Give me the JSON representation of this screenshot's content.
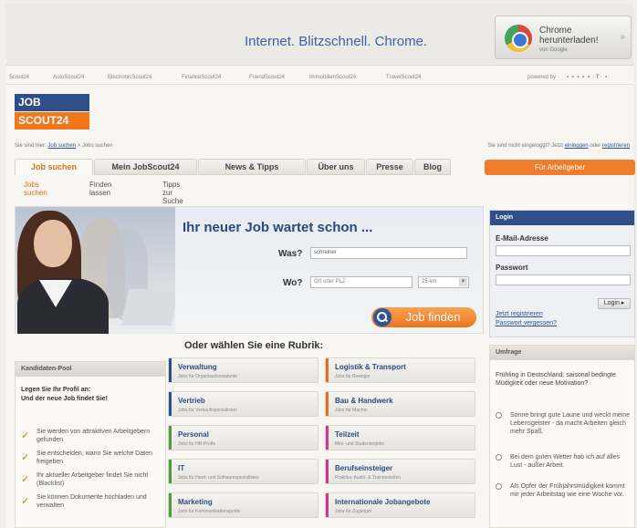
{
  "ad": {
    "slogan": "Internet. Blitzschnell. Chrome.",
    "chrome_line1": "Chrome",
    "chrome_line2": "herunterladen!",
    "chrome_sub": "von Google",
    "arrow": "»"
  },
  "network": {
    "links": [
      "Scout24",
      "AutoScout24",
      "ElectronicScout24",
      "FinanceScout24",
      "FriendScout24",
      "ImmobilienScout24",
      "TravelScout24"
    ],
    "powered_by": "powered by",
    "telekom": "• • • • • ·T· •"
  },
  "logo": {
    "line1": "JOB",
    "line2": "SCOUT24"
  },
  "breadcrumb": {
    "prefix": "Sie sind hier:",
    "link": "Job suchen",
    "current": "> Jobs suchen"
  },
  "login_status": {
    "text": "Sie sind nicht eingeloggt? Jetzt",
    "login_link": "einloggen",
    "or": "oder",
    "register_link": "registrieren"
  },
  "nav": {
    "tabs": [
      "Job suchen",
      "Mein JobScout24",
      "News & Tipps",
      "Über uns",
      "Presse",
      "Blog"
    ],
    "employer": "Für Arbeitgeber"
  },
  "subnav": [
    "Jobs suchen",
    "Finden lassen",
    "Tipps zur Suche"
  ],
  "hero": {
    "title": "Ihr neuer Job wartet schon ...",
    "was_label": "Was?",
    "was_value": "schreiner",
    "wo_label": "Wo?",
    "wo_placeholder": "Ort oder PLZ",
    "radius": "25 km",
    "button": "Job finden"
  },
  "pool": {
    "title": "Kandidaten-Pool",
    "intro_line1": "Legen Sie Ihr Profil an:",
    "intro_line2": "Und der neue Job findet Sie!",
    "items": [
      "Sie werden von attraktiven Arbeitgebern gefunden",
      "Sie entscheiden, wann Sie welche Daten freigeben",
      "Ihr aktueller Arbeitgeber findet Sie nicht (Blacklist)",
      "Sie können Dokumente hochladen und verwalten"
    ]
  },
  "rubrik": {
    "title": "Oder wählen Sie eine Rubrik:",
    "categories": [
      {
        "name": "Verwaltung",
        "sub": "Jobs für Organisationstalente",
        "color": "#2f4f89"
      },
      {
        "name": "Logistik & Transport",
        "sub": "Jobs für Beweger",
        "color": "#e07020"
      },
      {
        "name": "Vertrieb",
        "sub": "Jobs für Verkaufsspezialisten",
        "color": "#2f4f89"
      },
      {
        "name": "Bau & Handwerk",
        "sub": "Jobs für Macher",
        "color": "#e07020"
      },
      {
        "name": "Personal",
        "sub": "Jobs für HR-Profis",
        "color": "#4c9e3a"
      },
      {
        "name": "Teilzeit",
        "sub": "Mini- und Studentenjobs",
        "color": "#c93a8a"
      },
      {
        "name": "IT",
        "sub": "Jobs für Hard- und Softwarespezialisten",
        "color": "#4c9e3a"
      },
      {
        "name": "Berufseinsteiger",
        "sub": "Praktika, Ausbi- & Traineestellen",
        "color": "#c93a8a"
      },
      {
        "name": "Marketing",
        "sub": "Jobs für Kommunikationsprofis",
        "color": "#4c9e3a"
      },
      {
        "name": "Internationale Jobangebote",
        "sub": "Jobs für Zugvögel",
        "color": "#c93a8a"
      }
    ]
  },
  "login": {
    "title": "Login",
    "email_label": "E-Mail-Adresse",
    "password_label": "Passwort",
    "button": "Login ▸",
    "register": "Jetzt registrieren",
    "forgot": "Passwort vergessen?"
  },
  "poll": {
    "title": "Umfrage",
    "question": "Frühling in Deutschland: saisonal bedingte Müdigkeit oder neue Motivation?",
    "options": [
      "Sonne bringt gute Laune und weckt meine Lebensgeister - da macht Arbeiten gleich mehr Spaß.",
      "Bei dem guten Wetter hab ich auf alles Lust - außer Arbeit.",
      "Als Opfer der Frühjahrsmüdigkeit kommt mir jeder Arbeitstag wie eine Woche vor."
    ]
  }
}
